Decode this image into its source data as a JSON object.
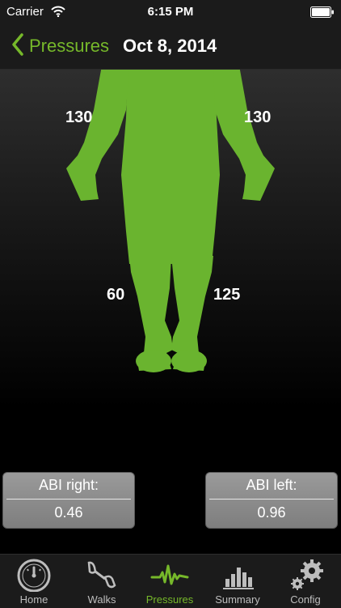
{
  "status_bar": {
    "carrier": "Carrier",
    "time": "6:15 PM"
  },
  "nav": {
    "back_label": "Pressures",
    "title": "Oct 8, 2014"
  },
  "pressures": {
    "right_arm": "130",
    "left_arm": "130",
    "right_ankle": "60",
    "left_ankle": "125"
  },
  "abi": {
    "right": {
      "label": "ABI right:",
      "value": "0.46"
    },
    "left": {
      "label": "ABI left:",
      "value": "0.96"
    }
  },
  "tabs": [
    {
      "label": "Home",
      "icon": "gauge-icon"
    },
    {
      "label": "Walks",
      "icon": "footsteps-icon"
    },
    {
      "label": "Pressures",
      "icon": "pulse-icon"
    },
    {
      "label": "Summary",
      "icon": "bar-chart-icon"
    },
    {
      "label": "Config",
      "icon": "gears-icon"
    }
  ],
  "colors": {
    "accent": "#76b82a",
    "figure": "#6ab42f",
    "tab_inactive": "#bdbdbd"
  }
}
